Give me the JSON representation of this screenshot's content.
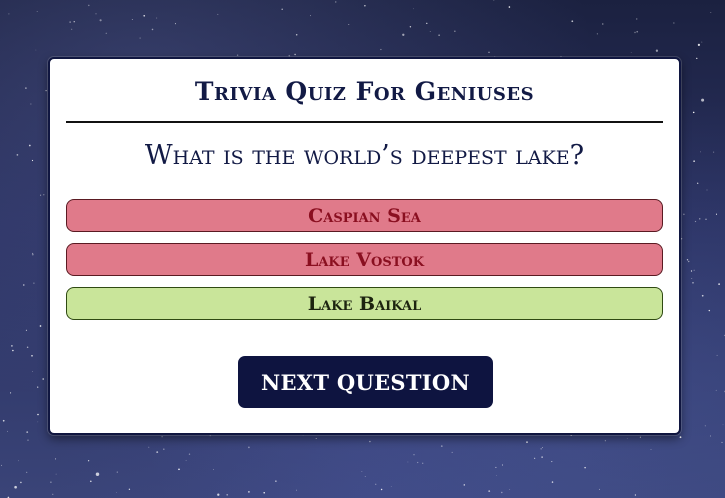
{
  "quiz": {
    "title": "Trivia Quiz For Geniuses",
    "question": "What is the world’s deepest lake?",
    "answers": [
      {
        "label": "Caspian Sea",
        "status": "incorrect"
      },
      {
        "label": "Lake Vostok",
        "status": "incorrect"
      },
      {
        "label": "Lake Baikal",
        "status": "correct"
      }
    ],
    "next_button_label": "NEXT QUESTION"
  },
  "colors": {
    "incorrect_fill": "#e07a8a",
    "incorrect_text": "#8a0f20",
    "correct_fill": "#c9e59a",
    "button_fill": "#0e1440",
    "title_text": "#121a45"
  }
}
